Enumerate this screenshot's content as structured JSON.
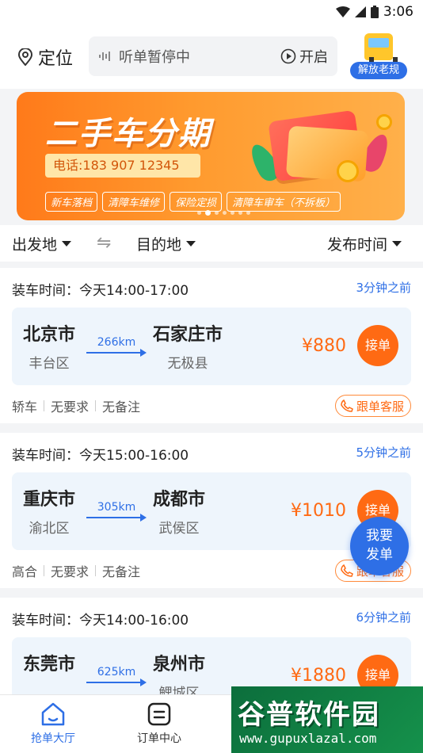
{
  "status_bar": {
    "time": "3:06"
  },
  "header": {
    "location_label": "定位",
    "listen_status": "听单暂停中",
    "listen_toggle": "开启",
    "promo_badge": "解放老规"
  },
  "banner": {
    "title": "二手车分期",
    "phone": "电话:183 907 12345",
    "tags": [
      "新车落档",
      "清障车维修",
      "保险定损",
      "清障车审车（不拆板）"
    ],
    "active_dot": 1,
    "dot_count": 7
  },
  "filters": {
    "origin": "出发地",
    "destination": "目的地",
    "publish_time": "发布时间"
  },
  "orders": [
    {
      "load_time": "装车时间：今天14:00-17:00",
      "ago": "3分钟之前",
      "from_city": "北京市",
      "from_district": "丰台区",
      "to_city": "石家庄市",
      "to_district": "无极县",
      "distance": "266km",
      "price": "¥880",
      "take_label": "接单",
      "vehicle": "轿车",
      "requirement": "无要求",
      "remark": "无备注",
      "service_label": "跟单客服"
    },
    {
      "load_time": "装车时间：今天15:00-16:00",
      "ago": "5分钟之前",
      "from_city": "重庆市",
      "from_district": "渝北区",
      "to_city": "成都市",
      "to_district": "武侯区",
      "distance": "305km",
      "price": "¥1010",
      "take_label": "接单",
      "vehicle": "高合",
      "requirement": "无要求",
      "remark": "无备注",
      "service_label": "跟单客服"
    },
    {
      "load_time": "装车时间：今天14:00-16:00",
      "ago": "6分钟之前",
      "from_city": "东莞市",
      "from_district": "",
      "to_city": "泉州市",
      "to_district": "鲤城区",
      "distance": "625km",
      "price": "¥1880",
      "take_label": "接单"
    }
  ],
  "fab": {
    "line1": "我要",
    "line2": "发单"
  },
  "tabs": [
    {
      "label": "抢单大厅",
      "icon": "home-icon",
      "active": true
    },
    {
      "label": "订单中心",
      "icon": "order-icon",
      "active": false
    }
  ],
  "watermark": {
    "title": "谷普软件园",
    "url": "www.gupuxlazal.com"
  },
  "colors": {
    "accent": "#2e6fe6",
    "price": "#ff6a13",
    "banner": "#ff8a22"
  }
}
